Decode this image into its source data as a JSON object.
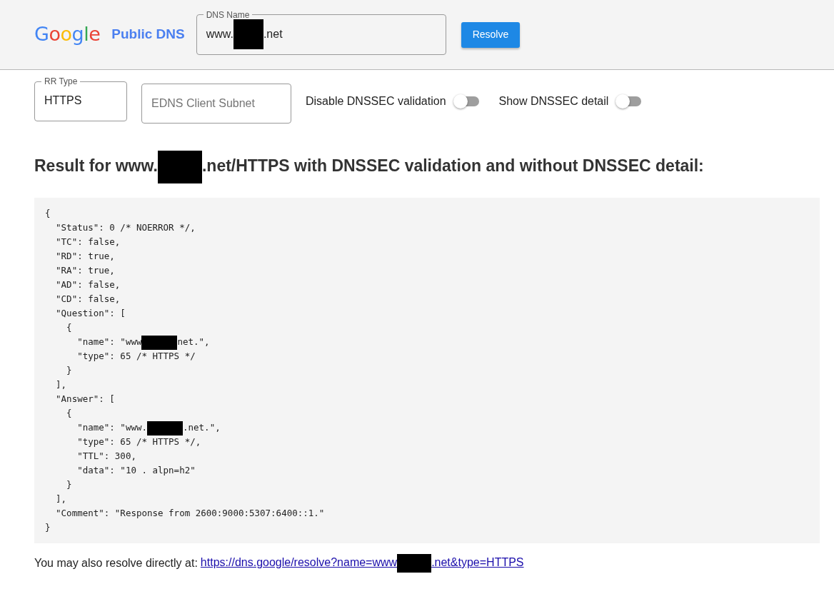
{
  "header": {
    "logo": "Google",
    "product": "Public DNS",
    "dns_name": {
      "label": "DNS Name",
      "value": [
        {
          "kind": "text",
          "text": "www."
        },
        {
          "kind": "redaction"
        },
        {
          "kind": "text",
          "text": ".net"
        }
      ]
    },
    "button": "Resolve"
  },
  "options": {
    "rr_type": {
      "label": "RR Type",
      "value": "HTTPS"
    },
    "subnet": {
      "placeholder": "EDNS Client Subnet"
    },
    "toggles": [
      {
        "label": "Disable DNSSEC validation",
        "on": false
      },
      {
        "label": "Show DNSSEC detail",
        "on": false
      }
    ]
  },
  "heading": [
    {
      "kind": "text",
      "text": "Result for www."
    },
    {
      "kind": "redaction"
    },
    {
      "kind": "text",
      "text": ".net/HTTPS with DNSSEC validation and without DNSSEC detail:"
    }
  ],
  "code_lines": [
    "{",
    "  \"Status\": 0 /* NOERROR */,",
    "  \"TC\": false,",
    "  \"RD\": true,",
    "  \"RA\": true,",
    "  \"AD\": false,",
    "  \"CD\": false,",
    "  \"Question\": [",
    "    {",
    [
      {
        "kind": "text",
        "text": "      \"name\": \"www"
      },
      {
        "kind": "redaction"
      },
      {
        "kind": "text",
        "text": "net.\","
      }
    ],
    "      \"type\": 65 /* HTTPS */",
    "    }",
    "  ],",
    "  \"Answer\": [",
    "    {",
    [
      {
        "kind": "text",
        "text": "      \"name\": \"www."
      },
      {
        "kind": "redaction"
      },
      {
        "kind": "text",
        "text": ".net.\","
      }
    ],
    "      \"type\": 65 /* HTTPS */,",
    "      \"TTL\": 300,",
    "      \"data\": \"10 . alpn=h2\"",
    "    }",
    "  ],",
    "  \"Comment\": \"Response from 2600:9000:5307:6400::1.\"",
    "}"
  ],
  "footer": {
    "text": "You may also resolve directly at:",
    "link": [
      {
        "kind": "text",
        "text": "https://dns.google/resolve?name=www"
      },
      {
        "kind": "redaction"
      },
      {
        "kind": "text",
        "text": ".net&type=HTTPS"
      }
    ]
  }
}
